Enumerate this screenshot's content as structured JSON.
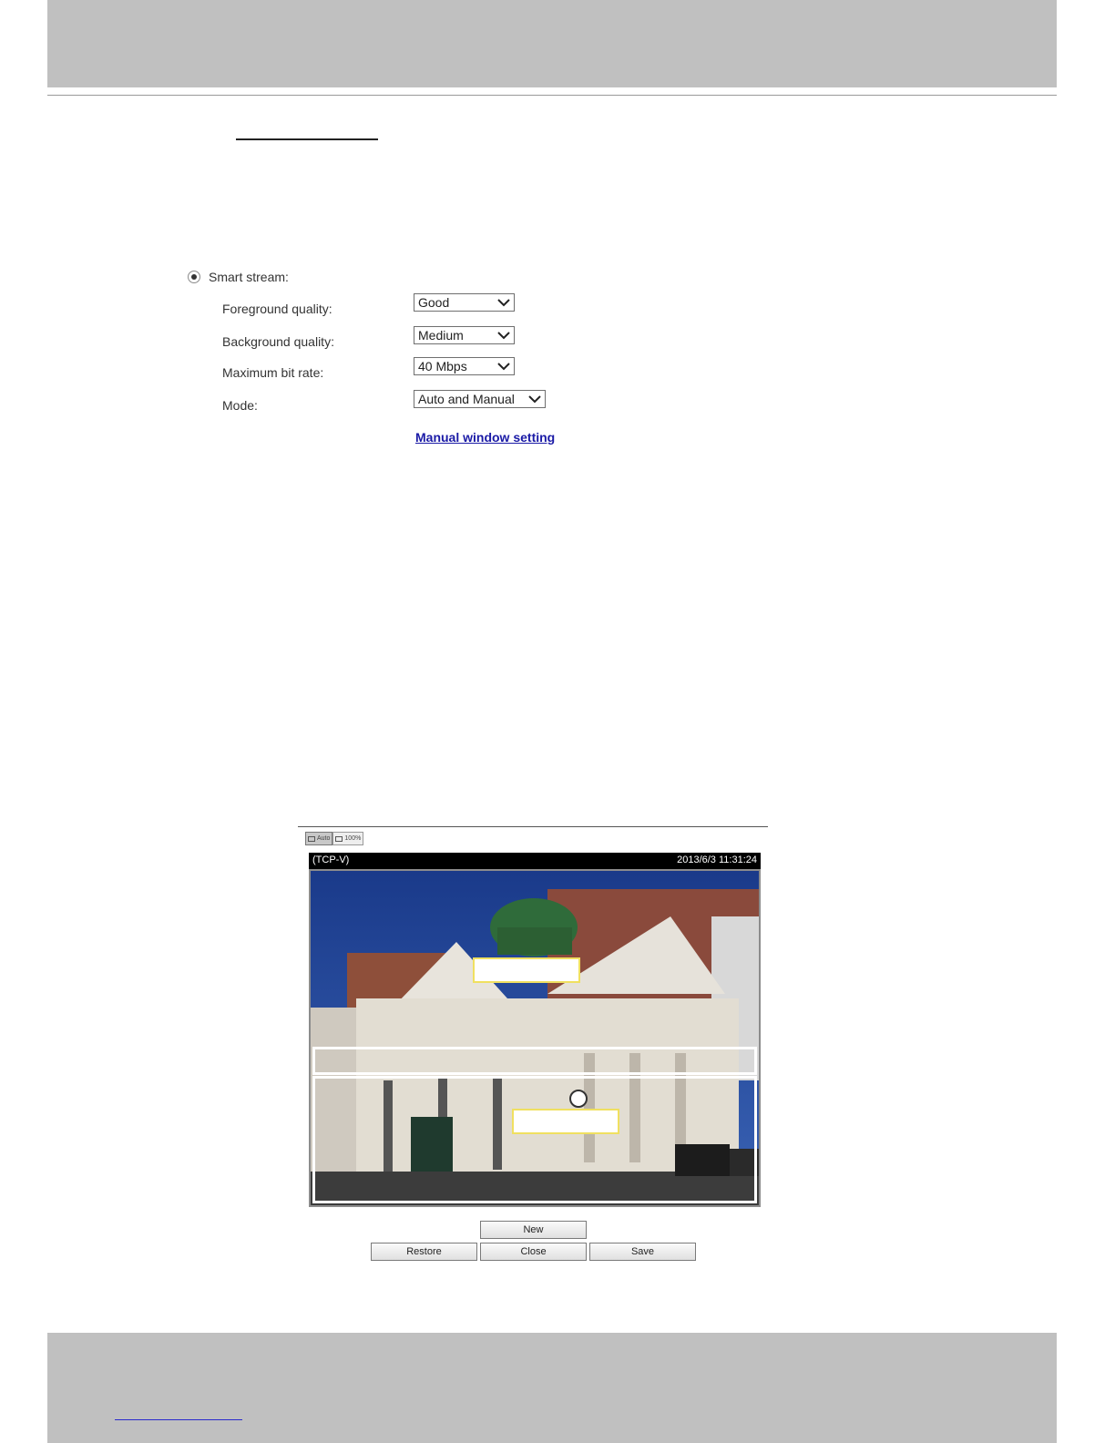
{
  "smart_stream": {
    "label": "Smart stream:",
    "selected": true,
    "fields": [
      {
        "label": "Foreground quality:",
        "value": "Good"
      },
      {
        "label": "Background quality:",
        "value": "Medium"
      },
      {
        "label": "Maximum bit rate:",
        "value": "40 Mbps"
      },
      {
        "label": "Mode:",
        "value": "Auto and Manual"
      }
    ],
    "manual_link": "Manual window setting"
  },
  "preview": {
    "zoom_buttons": [
      "Auto",
      "100%"
    ],
    "protocol": "(TCP-V)",
    "timestamp": "2013/6/3 11:31:24"
  },
  "buttons": {
    "new": "New",
    "restore": "Restore",
    "close": "Close",
    "save": "Save"
  },
  "colors": {
    "band": "#c0c0c0",
    "link": "#1a1aa6",
    "window_yellow": "#f0e060"
  }
}
